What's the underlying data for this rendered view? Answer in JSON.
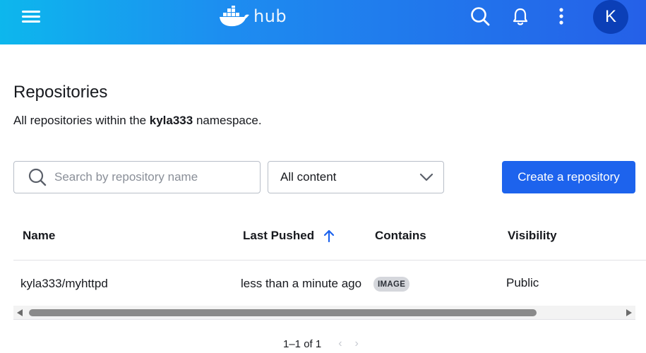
{
  "header": {
    "logo_text": "hub",
    "avatar_initial": "K",
    "brand_color": "#1d63ed"
  },
  "main": {
    "title": "Repositories",
    "subtitle_prefix": "All repositories within the ",
    "namespace": "kyla333",
    "subtitle_suffix": " namespace."
  },
  "controls": {
    "search_placeholder": "Search by repository name",
    "search_value": "",
    "filter_selected": "All content",
    "create_button": "Create a repository"
  },
  "table": {
    "columns": [
      "Name",
      "Last Pushed",
      "Contains",
      "Visibility"
    ],
    "sort_column": "Last Pushed",
    "sort_direction": "ascending",
    "rows": [
      {
        "name": "kyla333/myhttpd",
        "last_pushed": "less than a minute ago",
        "contains": "IMAGE",
        "visibility": "Public"
      }
    ]
  },
  "pagination": {
    "range_text": "1–1 of 1",
    "prev_icon": "‹",
    "next_icon": "›"
  },
  "icons": {
    "menu": "hamburger-icon",
    "search": "search-icon",
    "notifications": "bell-icon",
    "more": "kebab-icon",
    "dropdown": "chevron-down-icon",
    "sort": "arrow-up-icon"
  }
}
